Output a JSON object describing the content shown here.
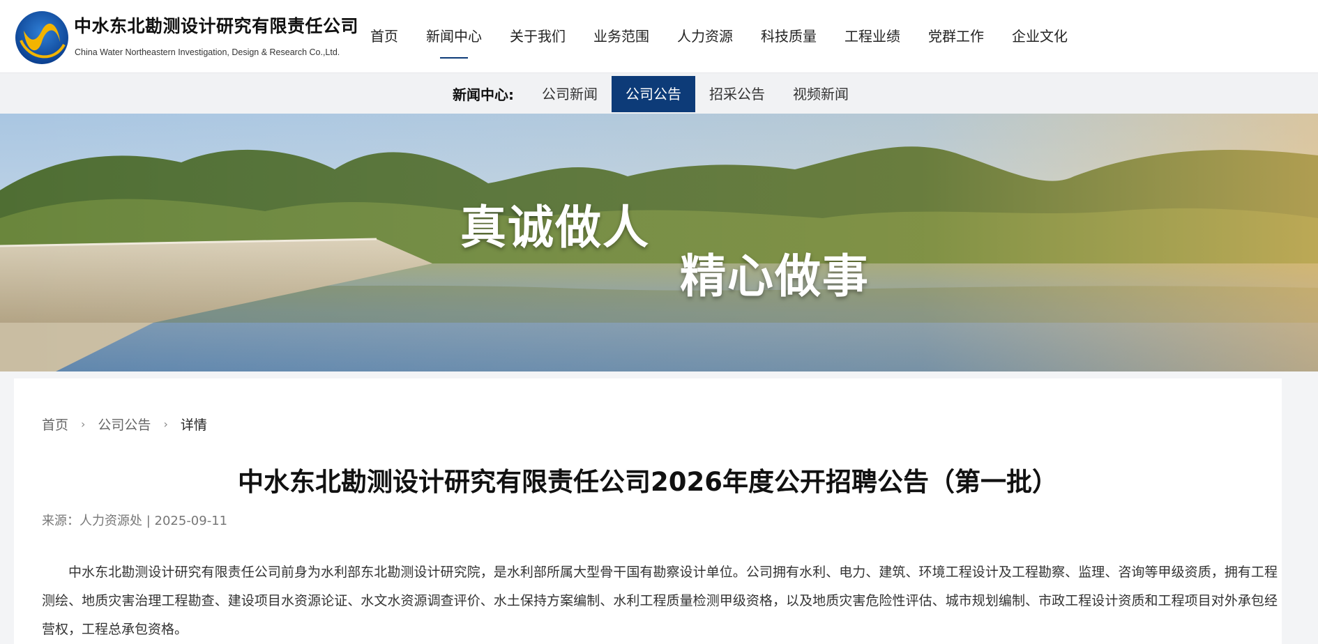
{
  "header": {
    "company_cn": "中水东北勘测设计研究有限责任公司",
    "company_en": "China Water Northeastern Investigation, Design & Research Co.,Ltd.",
    "nav": [
      {
        "label": "首页"
      },
      {
        "label": "新闻中心",
        "active": true
      },
      {
        "label": "关于我们"
      },
      {
        "label": "业务范围"
      },
      {
        "label": "人力资源"
      },
      {
        "label": "科技质量"
      },
      {
        "label": "工程业绩"
      },
      {
        "label": "党群工作"
      },
      {
        "label": "企业文化"
      }
    ]
  },
  "subnav": {
    "title": "新闻中心:",
    "items": [
      {
        "label": "公司新闻"
      },
      {
        "label": "公司公告",
        "active": true
      },
      {
        "label": "招采公告"
      },
      {
        "label": "视频新闻"
      }
    ]
  },
  "banner": {
    "slogan_1": "真诚做人",
    "slogan_2": "精心做事"
  },
  "breadcrumb": {
    "home": "首页",
    "section": "公司公告",
    "current": "详情",
    "separator": "›"
  },
  "article": {
    "title": "中水东北勘测设计研究有限责任公司2026年度公开招聘公告（第一批）",
    "meta": "来源：人力资源处 | 2025-09-11",
    "paragraph": "中水东北勘测设计研究有限责任公司前身为水利部东北勘测设计研究院，是水利部所属大型骨干国有勘察设计单位。公司拥有水利、电力、建筑、环境工程设计及工程勘察、监理、咨询等甲级资质，拥有工程测绘、地质灾害治理工程勘查、建设项目水资源论证、水文水资源调查评价、水土保持方案编制、水利工程质量检测甲级资格，以及地质灾害危险性评估、城市规划编制、市政工程设计资质和工程项目对外承包经营权，工程总承包资格。"
  },
  "colors": {
    "accent": "#0d3b78",
    "subnav_bg": "#f1f2f4",
    "page_bg": "#f3f4f6"
  }
}
